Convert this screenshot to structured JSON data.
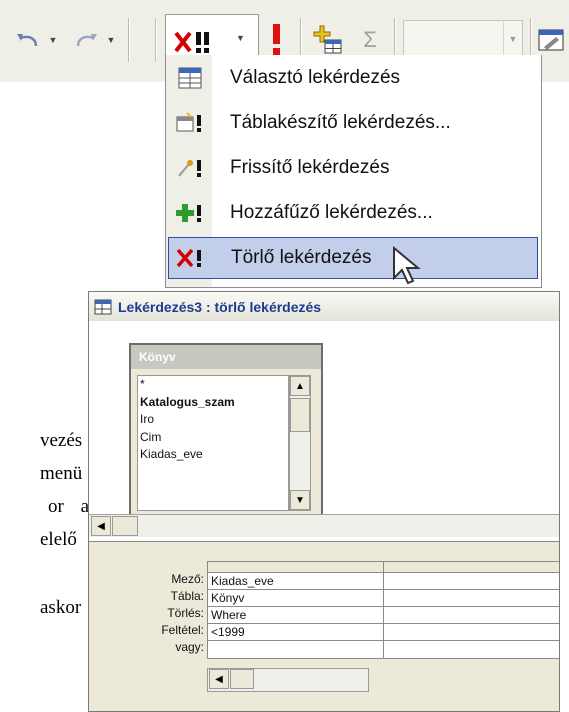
{
  "toolbar": {
    "undo_icon": "undo-icon",
    "redo_icon": "redo-icon",
    "query_type_icon": "delete-query-icon",
    "run_icon": "run-exclamation-icon",
    "show_table_icon": "show-table-icon",
    "totals_symbol": "Σ",
    "properties_icon": "properties-icon"
  },
  "menu": {
    "items": [
      {
        "label": "Választó lekérdezés",
        "icon": "select-query-icon"
      },
      {
        "label": "Táblakészítő lekérdezés...",
        "icon": "make-table-query-icon"
      },
      {
        "label": "Frissítő lekérdezés",
        "icon": "update-query-icon"
      },
      {
        "label": "Hozzáfűző lekérdezés...",
        "icon": "append-query-icon"
      },
      {
        "label": "Törlő lekérdezés",
        "icon": "delete-query-icon"
      }
    ],
    "active_index": 4
  },
  "window": {
    "title": "Lekérdezés3 : törlő lekérdezés",
    "table": {
      "name": "Könyv",
      "fields": [
        "*",
        "Katalogus_szam",
        "Iro",
        "Cim",
        "Kiadas_eve"
      ]
    },
    "grid": {
      "row_labels": [
        "Mező:",
        "Tábla:",
        "Törlés:",
        "Feltétel:",
        "vagy:"
      ],
      "columns": [
        {
          "values": [
            "Kiadas_eve",
            "Könyv",
            "Where",
            "<1999",
            ""
          ]
        },
        {
          "values": [
            "",
            "",
            "",
            "",
            ""
          ]
        }
      ]
    }
  },
  "background_text": [
    "vezés",
    "menü",
    "or a",
    "elelő",
    "askor"
  ],
  "colors": {
    "menu_highlight": "#c3cfea",
    "menu_highlight_border": "#2d4f9c",
    "title_text": "#1a3d8f",
    "delete_red": "#d40000"
  }
}
